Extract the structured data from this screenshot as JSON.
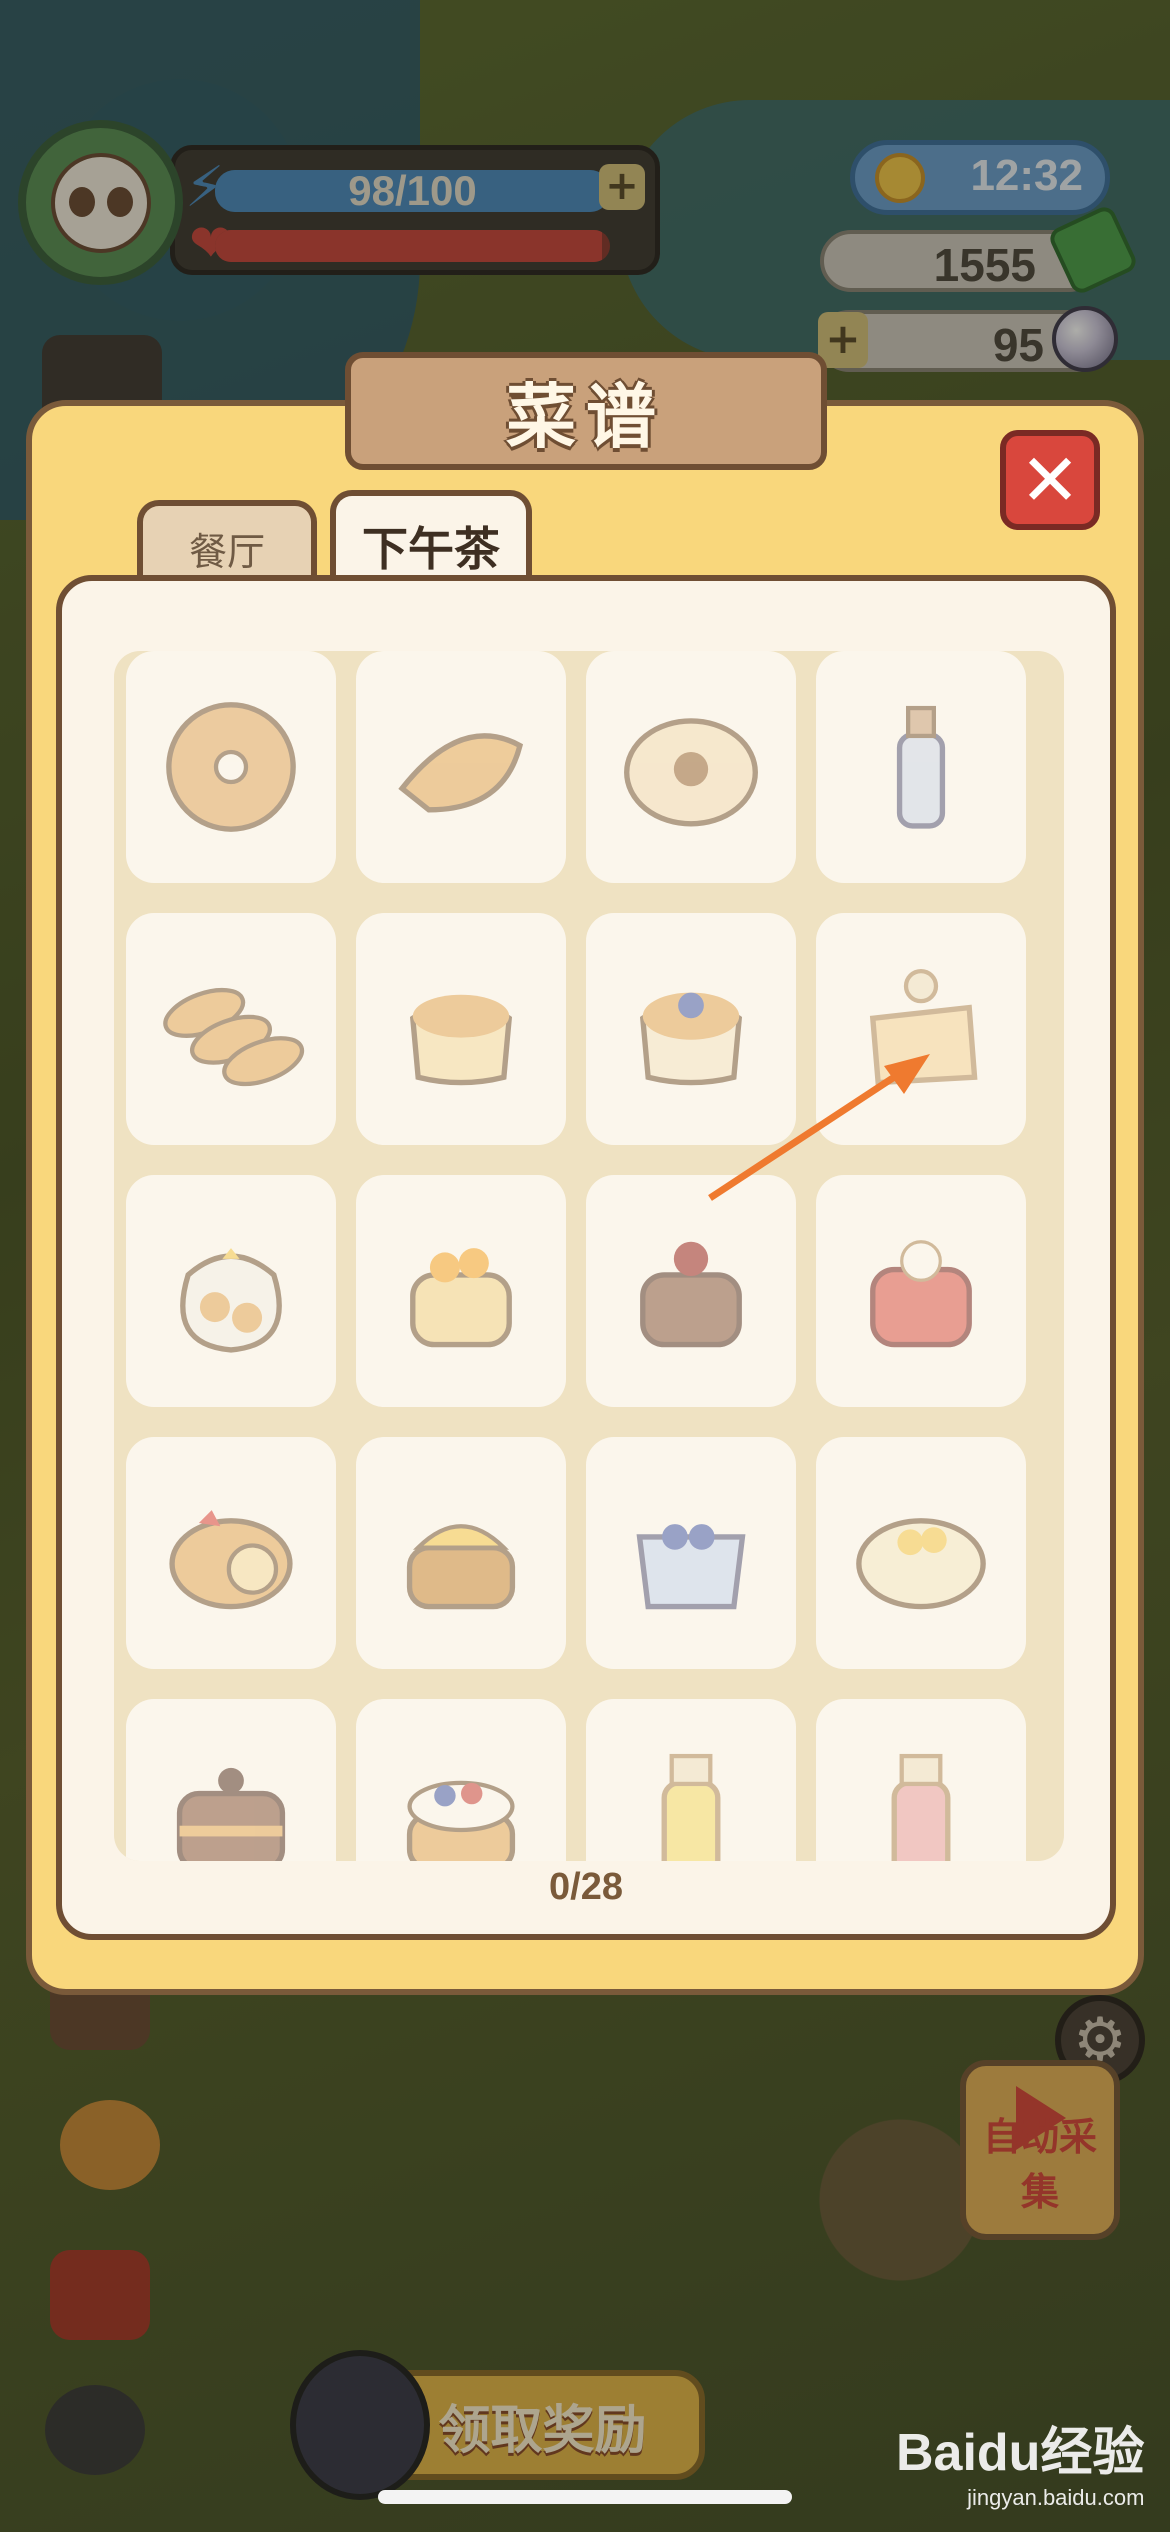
{
  "hud": {
    "energy_text": "98/100",
    "energy_fraction": 0.98,
    "heart_fraction": 0.98,
    "energy_plus": "+",
    "time": "12:32",
    "cash": "1555",
    "pearls": "95",
    "pearl_plus": "+"
  },
  "dialog": {
    "title": "菜谱",
    "close_label": "✕",
    "tabs": [
      {
        "label": "餐厅",
        "active": false
      },
      {
        "label": "下午茶",
        "active": true
      }
    ],
    "progress": "0/28",
    "items": [
      {
        "icon": "donut-icon"
      },
      {
        "icon": "croissant-icon"
      },
      {
        "icon": "flower-bun-icon"
      },
      {
        "icon": "bottle-drink-icon"
      },
      {
        "icon": "baguettes-icon"
      },
      {
        "icon": "pudding-icon"
      },
      {
        "icon": "blueberry-pudding-icon"
      },
      {
        "icon": "bagged-toast-icon"
      },
      {
        "icon": "cookie-bag-icon"
      },
      {
        "icon": "orange-cake-icon"
      },
      {
        "icon": "cherry-chocolate-cake-icon"
      },
      {
        "icon": "strawberry-cream-cake-icon"
      },
      {
        "icon": "swiss-roll-icon"
      },
      {
        "icon": "mango-tart-icon"
      },
      {
        "icon": "blueberry-jelly-icon"
      },
      {
        "icon": "fruit-bun-icon"
      },
      {
        "icon": "chocolate-layer-cake-icon"
      },
      {
        "icon": "berry-tart-icon"
      },
      {
        "icon": "lemon-juice-icon"
      },
      {
        "icon": "peach-juice-icon"
      }
    ]
  },
  "bottom": {
    "claim_label": "领取奖励",
    "auto_label": "自动采集"
  },
  "watermark": {
    "brand": "Baidu经验",
    "site": "jingyan.baidu.com"
  },
  "colors": {
    "dialog_bg": "#f9d77c",
    "panel_bg": "#fbf4e8",
    "border_brown": "#6f4e33",
    "close_red": "#d9473d",
    "arrow_orange": "#ef7a2f"
  }
}
